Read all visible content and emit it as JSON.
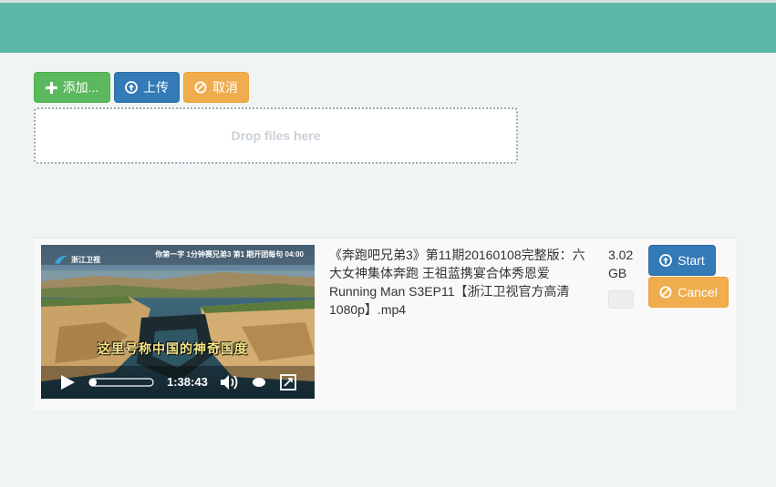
{
  "toolbar": {
    "add_label": "添加...",
    "upload_label": "上传",
    "cancel_label": "取消"
  },
  "dropzone": {
    "text": "Drop files here"
  },
  "file": {
    "name": "《奔跑吧兄弟3》第11期20160108完整版：六大女神集体奔跑 王祖蓝携宴合体秀恩爱 Running Man S3EP11【浙江卫视官方高清1080p】.mp4",
    "size": "3.02 GB",
    "progress": 0,
    "start_label": "Start",
    "cancel_label": "Cancel",
    "preview": {
      "duration": "1:38:43",
      "channel_logo_text": "浙江卫视",
      "overlay_caption": "这里号称中国的神奇国度",
      "top_banner_text": "你第一字 1分钟赛兄弟3 第1 期开团每句 04:00",
      "played_fraction": 0.05
    }
  },
  "colors": {
    "header": "#5bb8a7",
    "page_bg": "#eef5f3",
    "success": "#5cb85c",
    "primary": "#337ab7",
    "warning": "#f0ad4e"
  }
}
